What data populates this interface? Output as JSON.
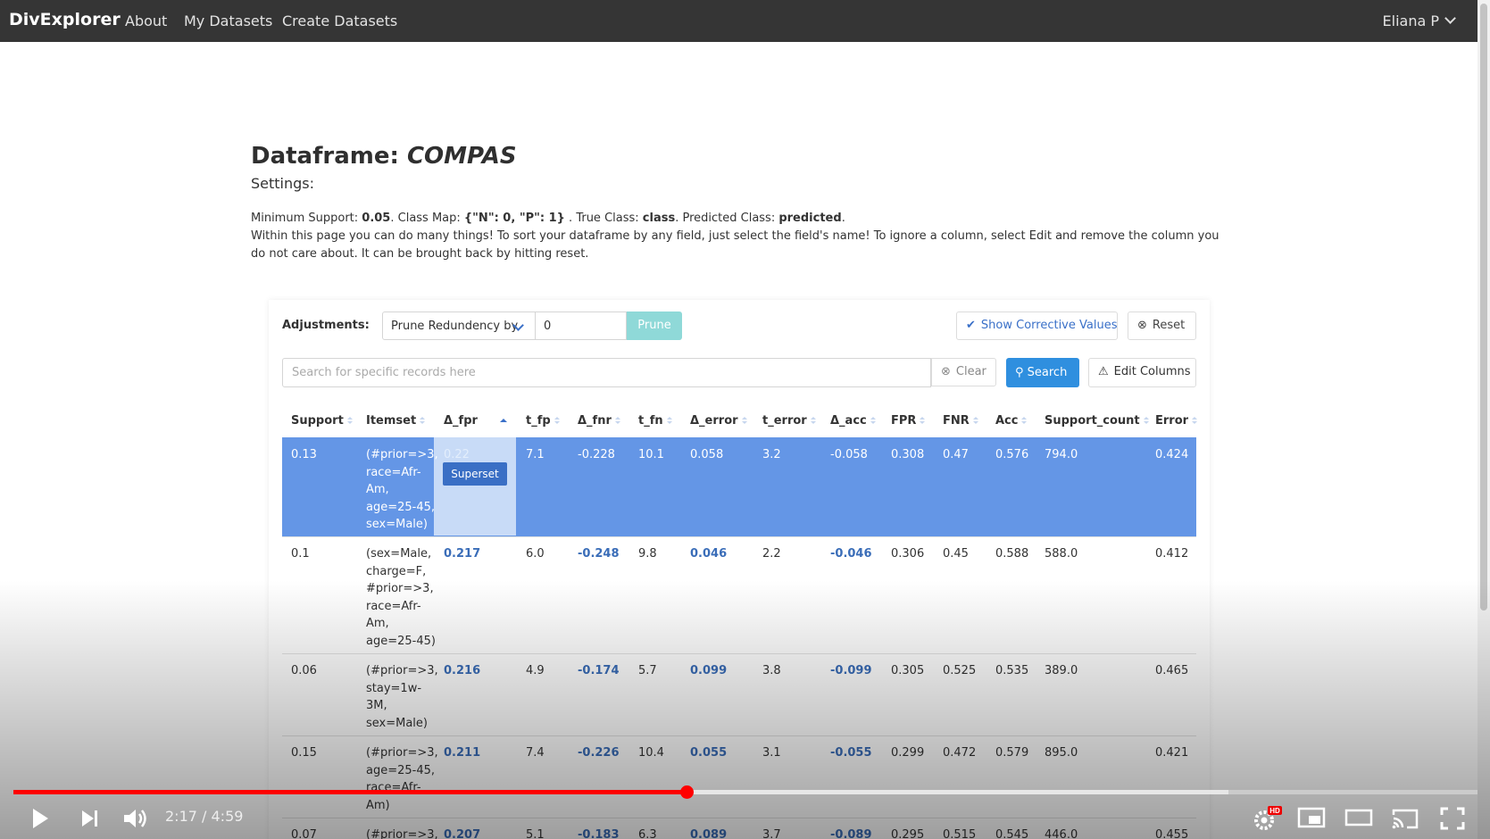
{
  "nav": {
    "brand": "DivExplorer",
    "links": [
      "About",
      "My Datasets",
      "Create Datasets"
    ],
    "user": "Eliana P"
  },
  "page": {
    "title_prefix": "Dataframe: ",
    "title_name": "COMPAS",
    "settings_label": "Settings:",
    "min_support_label": "Minimum Support: ",
    "min_support": "0.05",
    "class_map_label": ". Class Map: ",
    "class_map": "{\"N\": 0, \"P\": 1}",
    "true_class_label": " . True Class: ",
    "true_class": "class",
    "pred_class_label": ". Predicted Class: ",
    "pred_class": "predicted",
    "end": ".",
    "description": "Within this page you can do many things! To sort your dataframe by any field, just select the field's name! To ignore a column, select Edit and remove the column you do not care about. It can be brought back by hitting reset."
  },
  "controls": {
    "adjustments_label": "Adjustments:",
    "prune_select": "Prune Redundency by",
    "prune_value": "0",
    "prune_button": "Prune",
    "corrective_button": "Show Corrective Values",
    "reset_button": "Reset",
    "search_placeholder": "Search for specific records here",
    "clear_button": "Clear",
    "search_button": "Search",
    "edit_columns_button": "Edit Columns"
  },
  "table": {
    "columns": [
      "Support",
      "Itemset",
      "Δ_fpr",
      "t_fp",
      "Δ_fnr",
      "t_fn",
      "Δ_error",
      "t_error",
      "Δ_acc",
      "FPR",
      "FNR",
      "Acc",
      "Support_count",
      "Error"
    ],
    "sorted_column": "Δ_fpr",
    "tooltip": "Superset",
    "rows": [
      {
        "support": "0.13",
        "itemset": [
          "(#prior=>3,",
          "race=Afr-",
          "Am,",
          "age=25-45,",
          "sex=Male)"
        ],
        "d_fpr": "0.22",
        "t_fp": "7.1",
        "d_fnr": "-0.228",
        "t_fn": "10.1",
        "d_error": "0.058",
        "t_error": "3.2",
        "d_acc": "-0.058",
        "fpr": "0.308",
        "fnr": "0.47",
        "acc": "0.576",
        "support_count": "794.0",
        "error": "0.424"
      },
      {
        "support": "0.1",
        "itemset": [
          "(sex=Male,",
          "charge=F,",
          "#prior=>3,",
          "race=Afr-",
          "Am,",
          "age=25-45)"
        ],
        "d_fpr": "0.217",
        "t_fp": "6.0",
        "d_fnr": "-0.248",
        "t_fn": "9.8",
        "d_error": "0.046",
        "t_error": "2.2",
        "d_acc": "-0.046",
        "fpr": "0.306",
        "fnr": "0.45",
        "acc": "0.588",
        "support_count": "588.0",
        "error": "0.412"
      },
      {
        "support": "0.06",
        "itemset": [
          "(#prior=>3,",
          "stay=1w-",
          "3M,",
          "sex=Male)"
        ],
        "d_fpr": "0.216",
        "t_fp": "4.9",
        "d_fnr": "-0.174",
        "t_fn": "5.7",
        "d_error": "0.099",
        "t_error": "3.8",
        "d_acc": "-0.099",
        "fpr": "0.305",
        "fnr": "0.525",
        "acc": "0.535",
        "support_count": "389.0",
        "error": "0.465"
      },
      {
        "support": "0.15",
        "itemset": [
          "(#prior=>3,",
          "age=25-45,",
          "race=Afr-",
          "Am)"
        ],
        "d_fpr": "0.211",
        "t_fp": "7.4",
        "d_fnr": "-0.226",
        "t_fn": "10.4",
        "d_error": "0.055",
        "t_error": "3.1",
        "d_acc": "-0.055",
        "fpr": "0.299",
        "fnr": "0.472",
        "acc": "0.579",
        "support_count": "895.0",
        "error": "0.421"
      },
      {
        "support": "0.07",
        "itemset": [
          "(#prior=>3,"
        ],
        "d_fpr": "0.207",
        "t_fp": "5.1",
        "d_fnr": "-0.183",
        "t_fn": "6.3",
        "d_error": "0.089",
        "t_error": "3.7",
        "d_acc": "-0.089",
        "fpr": "0.295",
        "fnr": "0.515",
        "acc": "0.545",
        "support_count": "446.0",
        "error": "0.455"
      }
    ]
  },
  "player": {
    "time": "2:17 / 4:59",
    "progress": 0.46,
    "buffered": 0.83,
    "hd_badge": "HD"
  }
}
